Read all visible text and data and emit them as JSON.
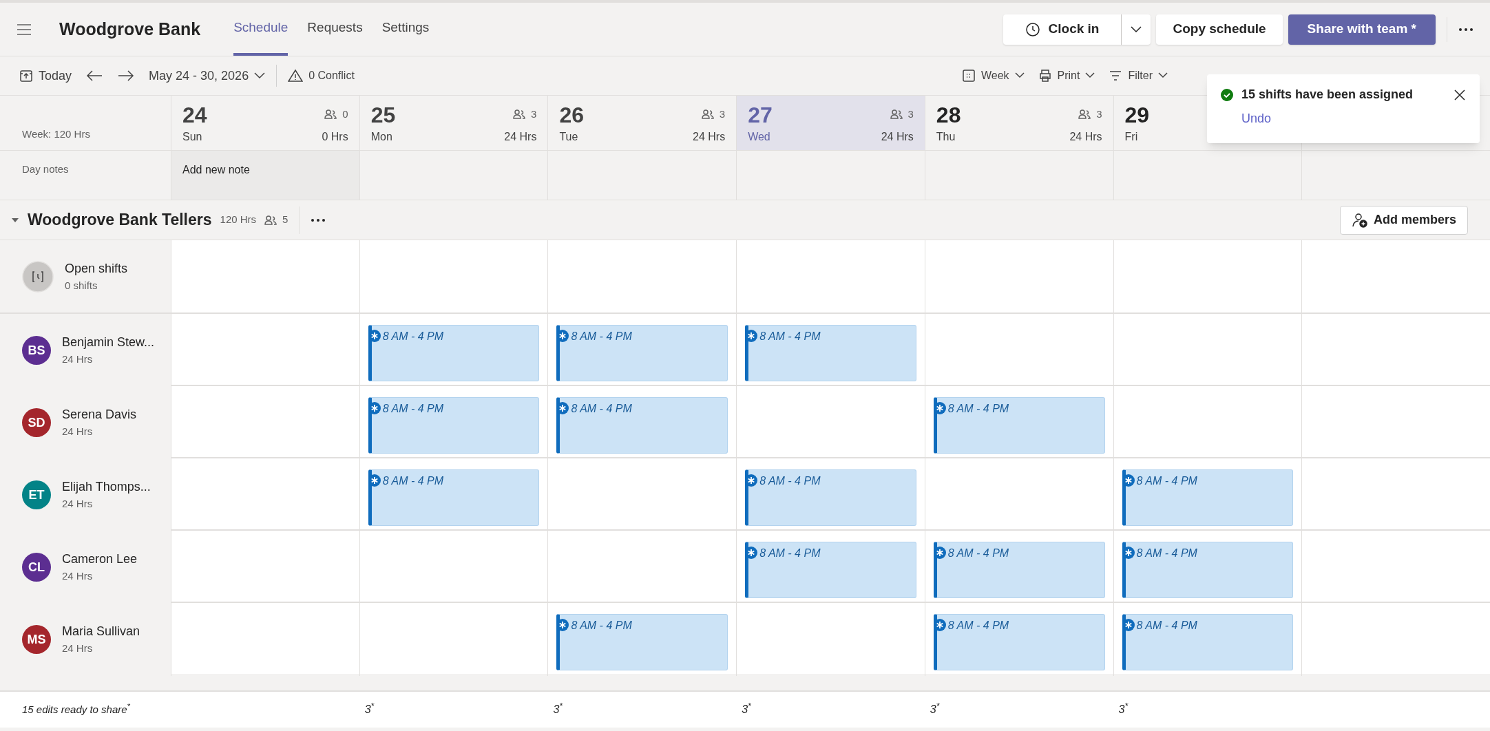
{
  "app": {
    "title": "Woodgrove Bank"
  },
  "tabs": [
    {
      "label": "Schedule",
      "selected": true
    },
    {
      "label": "Requests",
      "selected": false
    },
    {
      "label": "Settings",
      "selected": false
    }
  ],
  "header_buttons": {
    "clock_in": "Clock in",
    "copy": "Copy schedule",
    "share": "Share with team *"
  },
  "toolbar": {
    "today": "Today",
    "date_range": "May 24 - 30, 2026",
    "conflicts": "0 Conflict",
    "view": "Week",
    "print": "Print",
    "filter": "Filter"
  },
  "week_total": "Week: 120 Hrs",
  "day_notes_label": "Day notes",
  "days": [
    {
      "number": "24",
      "name": "Sun",
      "people": "0",
      "hours": "0 Hrs",
      "selected": false,
      "note": "Add new note"
    },
    {
      "number": "25",
      "name": "Mon",
      "people": "3",
      "hours": "24 Hrs",
      "selected": false,
      "edits": "3$^{*}$"
    },
    {
      "number": "26",
      "name": "Tue",
      "people": "3",
      "hours": "24 Hrs",
      "selected": false,
      "edits": "3$^{*}$"
    },
    {
      "number": "27",
      "name": "Wed",
      "people": "3",
      "hours": "24 Hrs",
      "selected": true,
      "edits": "3$^{*}$"
    },
    {
      "number": "28",
      "name": "Thu",
      "people": "3",
      "hours": "24 Hrs",
      "selected": false,
      "edits": "3$^{*}$"
    },
    {
      "number": "29",
      "name": "Fri",
      "selected": false,
      "edits": "3$^{*}$"
    },
    {
      "selected": false
    }
  ],
  "group": {
    "name": "Woodgrove Bank Tellers",
    "hours": "120 Hrs",
    "members": "5",
    "expanded": true,
    "add_members": "Add members"
  },
  "open_shifts": {
    "title": "Open shifts",
    "count": "0 shifts"
  },
  "people": [
    {
      "initials": "BS",
      "color": "#5c2e91",
      "name": "Benjamin Stew...",
      "hours": "24 Hrs",
      "cells": [
        {
          "kind": "empty"
        },
        {
          "kind": "shift",
          "time": "8 AM - 4 PM"
        },
        {
          "kind": "shift",
          "time": "8 AM - 4 PM"
        },
        {
          "kind": "shift",
          "time": "8 AM - 4 PM"
        },
        {
          "kind": "empty"
        },
        {
          "kind": "empty"
        },
        {
          "kind": "empty"
        }
      ]
    },
    {
      "initials": "SD",
      "color": "#a4262c",
      "name": "Serena Davis",
      "hours": "24 Hrs",
      "cells": [
        {
          "kind": "empty"
        },
        {
          "kind": "shift",
          "time": "8 AM - 4 PM"
        },
        {
          "kind": "shift",
          "time": "8 AM - 4 PM"
        },
        {
          "kind": "empty"
        },
        {
          "kind": "shift",
          "time": "8 AM - 4 PM"
        },
        {
          "kind": "empty"
        },
        {
          "kind": "empty"
        }
      ]
    },
    {
      "initials": "ET",
      "color": "#038387",
      "name": "Elijah Thomps...",
      "hours": "24 Hrs",
      "cells": [
        {
          "kind": "empty"
        },
        {
          "kind": "shift",
          "time": "8 AM - 4 PM"
        },
        {
          "kind": "empty"
        },
        {
          "kind": "shift",
          "time": "8 AM - 4 PM"
        },
        {
          "kind": "empty"
        },
        {
          "kind": "shift",
          "time": "8 AM - 4 PM"
        },
        {
          "kind": "empty"
        }
      ]
    },
    {
      "initials": "CL",
      "color": "#5c2e91",
      "name": "Cameron Lee",
      "hours": "24 Hrs",
      "cells": [
        {
          "kind": "empty"
        },
        {
          "kind": "empty"
        },
        {
          "kind": "empty"
        },
        {
          "kind": "shift",
          "time": "8 AM - 4 PM"
        },
        {
          "kind": "shift",
          "time": "8 AM - 4 PM"
        },
        {
          "kind": "shift",
          "time": "8 AM - 4 PM"
        },
        {
          "kind": "empty"
        }
      ]
    },
    {
      "initials": "MS",
      "color": "#a4262c",
      "name": "Maria Sullivan",
      "hours": "24 Hrs",
      "cells": [
        {
          "kind": "empty"
        },
        {
          "kind": "empty"
        },
        {
          "kind": "shift",
          "time": "8 AM - 4 PM"
        },
        {
          "kind": "empty"
        },
        {
          "kind": "shift",
          "time": "8 AM - 4 PM"
        },
        {
          "kind": "shift",
          "time": "8 AM - 4 PM"
        },
        {
          "kind": "empty"
        }
      ]
    }
  ],
  "footer": {
    "summary": "15 edits ready to share$^{*}$"
  },
  "toast": {
    "message": "15 shifts have been assigned",
    "action": "Undo"
  }
}
